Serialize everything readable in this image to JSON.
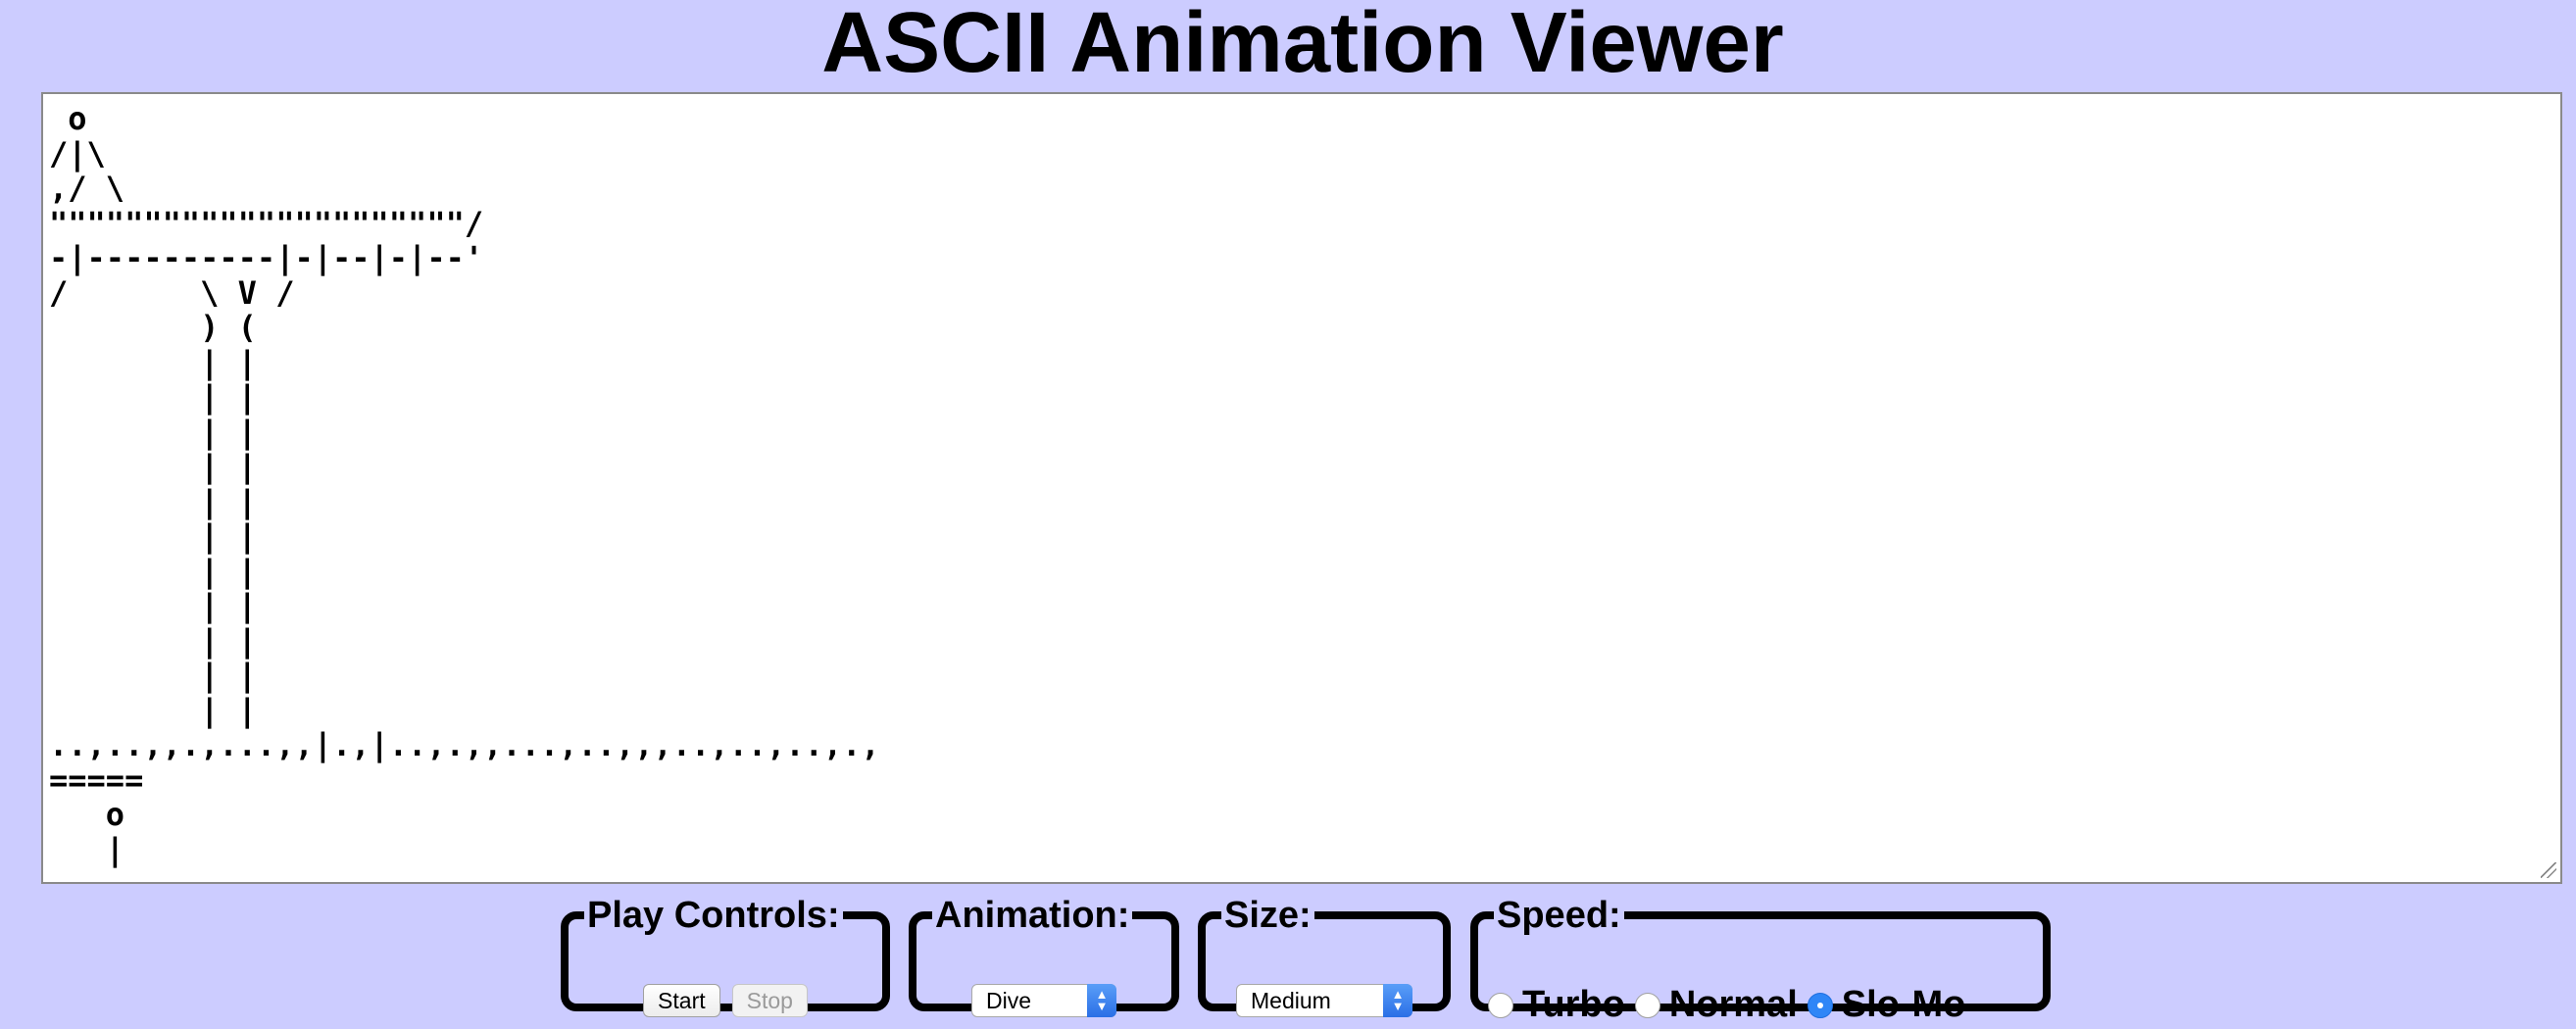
{
  "title": "ASCII Animation Viewer",
  "animation_text": " o\n/|\\\n,/ \\\n\"\"\"\"\"\"\"\"\"\"\"\"\"\"\"\"\"\"\"\"\"\"/\n-|----------|-|--|-|--'\n/       \\ V /\n        ) (\n        | |\n        | |\n        | |\n        | |\n        | |\n        | |\n        | |\n        | |\n        | |\n        | |\n        | |\n..,..,,.,...,,|.,|..,.,,...,..,,,..,..,..,.,\n=====\n   o\n   |",
  "play_controls": {
    "legend": "Play Controls:",
    "start_label": "Start",
    "stop_label": "Stop"
  },
  "animation": {
    "legend": "Animation:",
    "selected": "Dive"
  },
  "size": {
    "legend": "Size:",
    "selected": "Medium"
  },
  "speed": {
    "legend": "Speed:",
    "options": [
      {
        "label": "Turbo",
        "checked": false
      },
      {
        "label": "Normal",
        "checked": false
      },
      {
        "label": "Slo-Mo",
        "checked": true
      }
    ]
  }
}
